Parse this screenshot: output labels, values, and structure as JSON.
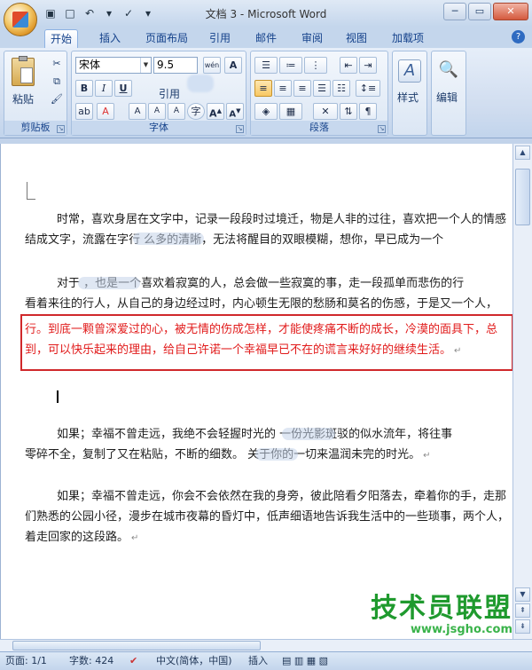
{
  "window": {
    "title": "文档 3 - Microsoft Word"
  },
  "tabs": [
    "开始",
    "插入",
    "页面布局",
    "引用",
    "邮件",
    "审阅",
    "视图",
    "加载项"
  ],
  "help_label": "?",
  "ribbon": {
    "clipboard": {
      "paste_label": "粘贴",
      "group_label": "剪贴板"
    },
    "font": {
      "font_name": "宋体",
      "font_size": "9.5",
      "wen_label": "wén",
      "char_border_label": "A",
      "bold_label": "B",
      "italic_label": "I",
      "underline_label": "U",
      "ref_label": "引用",
      "grow_label": "A",
      "shrink_label": "A",
      "phonetic_label": "A",
      "enclose_label": "字",
      "group_label": "字体"
    },
    "paragraph": {
      "group_label": "段落"
    },
    "styles": {
      "label": "样式"
    },
    "editing": {
      "label": "编辑"
    }
  },
  "document": {
    "paragraphs": [
      {
        "lines": [
          "时常，喜欢身居在文字中，记录一段段时过境迁，物是人非的过往，喜欢把一个人的情感",
          "结成文字，流露在字行                    么多的清晰，无法将醒目的双眼模糊，想你，早已成为一个"
        ],
        "red": false
      },
      {
        "lines": [
          "对于              ，也是一个喜欢着寂寞的人，总会做一些寂寞的事，走一段孤单而悲伤的行",
          "看着来往的行人，从自己的身边经过时，内心顿生无限的愁肠和莫名的伤感，于是又一个人，"
        ],
        "red": false
      },
      {
        "lines": [
          "行。到底一颗曾深爱过的心，被无情的伤成怎样，才能使疼痛不断的成长，冷漠的面具下，总",
          "到，可以快乐起来的理由，给自己许诺一个幸福早已不在的谎言来好好的继续生活。"
        ],
        "red": true
      },
      {
        "lines": [
          "如果；幸福不曾走远，我绝不会轻握时光的              一份光影斑驳的似水流年，将往事",
          "零碎不全，复制了又在粘贴，不断的细数。            关于你的一切来温润未完的时光。"
        ],
        "red": false
      },
      {
        "lines": [
          "如果；幸福不曾走远，你会不会依然在我的身旁，彼此陪看夕阳落去，牵着你的手，走那",
          "们熟悉的公园小径，漫步在城市夜幕的昏灯中，低声细语地告诉我生活中的一些琐事，两个人，",
          "着走回家的这段路。"
        ],
        "red": false
      }
    ],
    "return_mark": "↵"
  },
  "status_bar": {
    "page": "页面: 1/1",
    "words": "字数: 424",
    "language": "中文(简体，中国)",
    "mode": "插入"
  },
  "watermark": {
    "main": "技术员联盟",
    "url": "www.jsgho.com"
  },
  "colors": {
    "highlight_border": "#d0282b",
    "red_text": "#e11b1b",
    "watermark": "#1f9a2e"
  }
}
